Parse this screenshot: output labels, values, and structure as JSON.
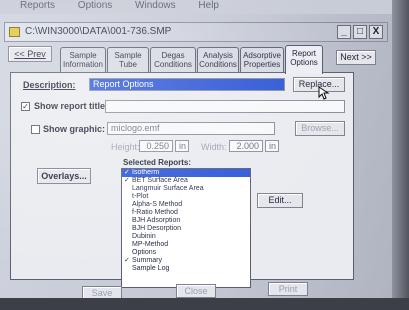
{
  "menu": [
    "Reports",
    "Options",
    "Windows",
    "Help"
  ],
  "window": {
    "title": "C:\\WIN3000\\DATA\\001-736.SMP",
    "minimize": "_",
    "maximize": "□",
    "close": "X"
  },
  "nav": {
    "prev": "<< Prev",
    "next": "Next >>"
  },
  "tabs": [
    {
      "line1": "Sample",
      "line2": "Information"
    },
    {
      "line1": "Sample",
      "line2": "Tube"
    },
    {
      "line1": "Degas",
      "line2": "Conditions"
    },
    {
      "line1": "Analysis",
      "line2": "Conditions"
    },
    {
      "line1": "Adsorptive",
      "line2": "Properties"
    },
    {
      "line1": "Report",
      "line2": "Options"
    }
  ],
  "description": {
    "label": "Description:",
    "value": "Report Options",
    "replace": "Replace..."
  },
  "report_title": {
    "label": "Show report title",
    "checked": true,
    "value": ""
  },
  "graphic": {
    "label": "Show graphic:",
    "checked": false,
    "value": "miclogo.emf",
    "browse": "Browse...",
    "height_label": "Height:",
    "height_value": "0.250",
    "height_unit": "in",
    "width_label": "Width:",
    "width_value": "2.000",
    "width_unit": "in"
  },
  "overlays": "Overlays...",
  "selected_reports": {
    "label": "Selected Reports:",
    "edit": "Edit...",
    "items": [
      {
        "text": "Isotherm",
        "checked": true,
        "highlight": true
      },
      {
        "text": "BET Surface Area",
        "checked": true,
        "highlight": false
      },
      {
        "text": "Langmuir Surface Area",
        "checked": false,
        "highlight": false
      },
      {
        "text": "t-Plot",
        "checked": false,
        "highlight": false
      },
      {
        "text": "Alpha-S Method",
        "checked": false,
        "highlight": false
      },
      {
        "text": "f-Ratio Method",
        "checked": false,
        "highlight": false
      },
      {
        "text": "BJH Adsorption",
        "checked": false,
        "highlight": false
      },
      {
        "text": "BJH Desorption",
        "checked": false,
        "highlight": false
      },
      {
        "text": "Dubinin",
        "checked": false,
        "highlight": false
      },
      {
        "text": "MP-Method",
        "checked": false,
        "highlight": false
      },
      {
        "text": "Options",
        "checked": false,
        "highlight": false
      },
      {
        "text": "Summary",
        "checked": true,
        "highlight": false
      },
      {
        "text": "Sample Log",
        "checked": false,
        "highlight": false
      }
    ]
  },
  "bottom": {
    "save": "Save",
    "close": "Close",
    "print": "Print"
  }
}
